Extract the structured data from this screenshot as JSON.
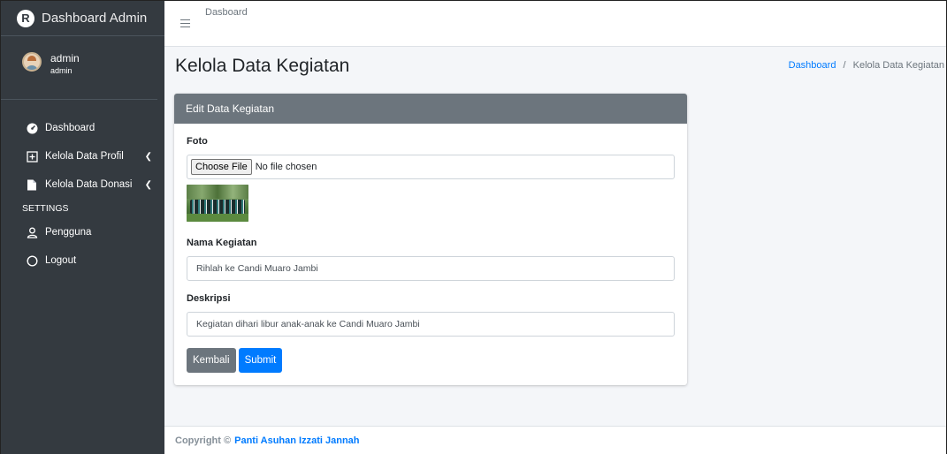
{
  "brand": {
    "logo_letter": "R",
    "title": "Dashboard Admin"
  },
  "user": {
    "name": "admin",
    "role": "admin"
  },
  "sidebar": {
    "items": [
      {
        "label": "Dashboard",
        "icon": "dashboard-icon"
      },
      {
        "label": "Kelola Data Profil",
        "icon": "plus-square-icon"
      },
      {
        "label": "Kelola Data Donasi",
        "icon": "file-icon"
      }
    ],
    "settings_header": "SETTINGS",
    "settings_items": [
      {
        "label": "Pengguna",
        "icon": "user-icon"
      },
      {
        "label": "Logout",
        "icon": "circle-icon"
      }
    ]
  },
  "topbar": {
    "link": "Dasboard"
  },
  "page": {
    "title": "Kelola Data Kegiatan",
    "breadcrumb": {
      "home": "Dashboard",
      "separator": "/",
      "current": "Kelola Data Kegiatan"
    }
  },
  "card": {
    "header": "Edit Data Kegiatan",
    "foto_label": "Foto",
    "file_button": "Choose File",
    "file_status": "No file chosen",
    "nama_label": "Nama Kegiatan",
    "nama_value": "Rihlah ke Candi Muaro Jambi",
    "deskripsi_label": "Deskripsi",
    "deskripsi_value": "Kegiatan dihari libur anak-anak ke Candi Muaro Jambi",
    "back_button": "Kembali",
    "submit_button": "Submit"
  },
  "footer": {
    "prefix": "Copyright ©",
    "link": "Panti Asuhan Izzati Jannah"
  },
  "colors": {
    "sidebar": "#343a40",
    "card_header": "#6c757d",
    "primary": "#007bff"
  }
}
